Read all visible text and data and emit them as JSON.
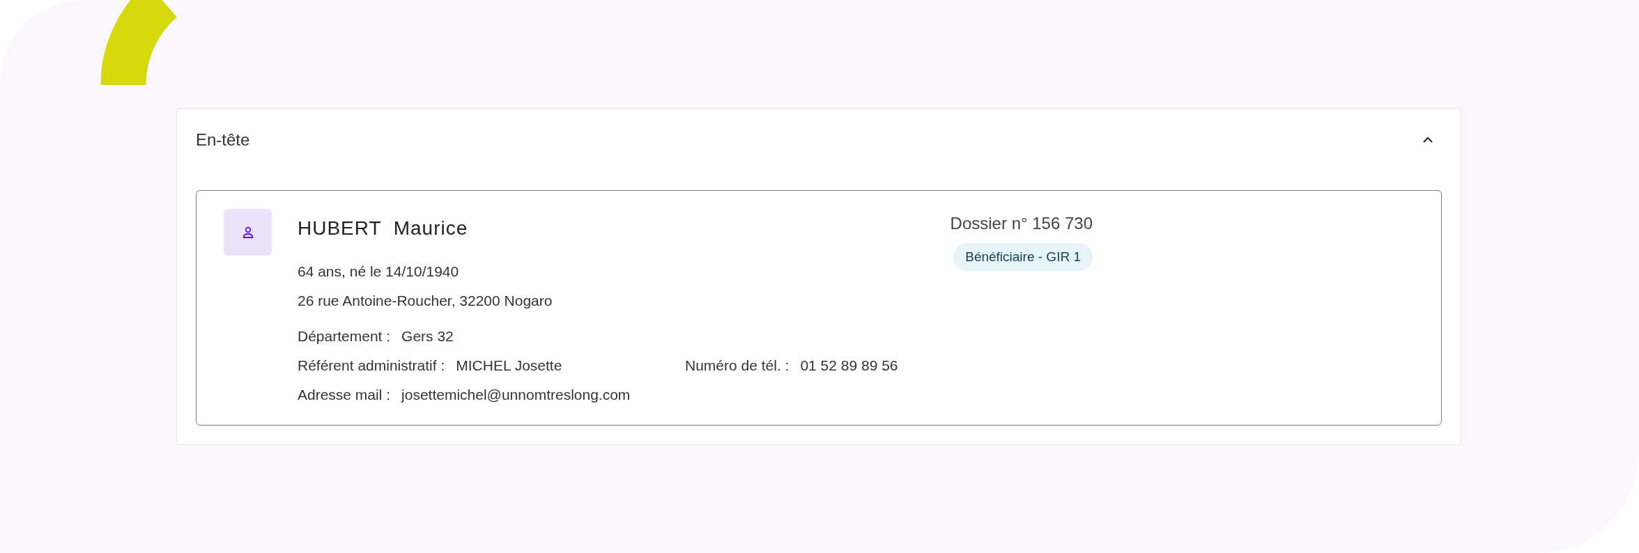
{
  "section": {
    "title": "En-tête",
    "expanded": true
  },
  "beneficiary": {
    "name": "HUBERT  Maurice",
    "age_birth": "64 ans, né le 14/10/1940",
    "address": "26 rue Antoine-Roucher, 32200 Nogaro",
    "dossier": "Dossier n° 156 730",
    "badge": "Bénéficiaire - GIR 1",
    "details": [
      {
        "label": "Département :",
        "value": "Gers 32"
      },
      {
        "label": "Référent administratif :",
        "value": "MICHEL Josette",
        "side_label": "Numéro de tél. :",
        "side_value": "01 52 89 89 56"
      },
      {
        "label": "Adresse mail :",
        "value": "josettemichel@unnomtreslong.com"
      }
    ]
  }
}
